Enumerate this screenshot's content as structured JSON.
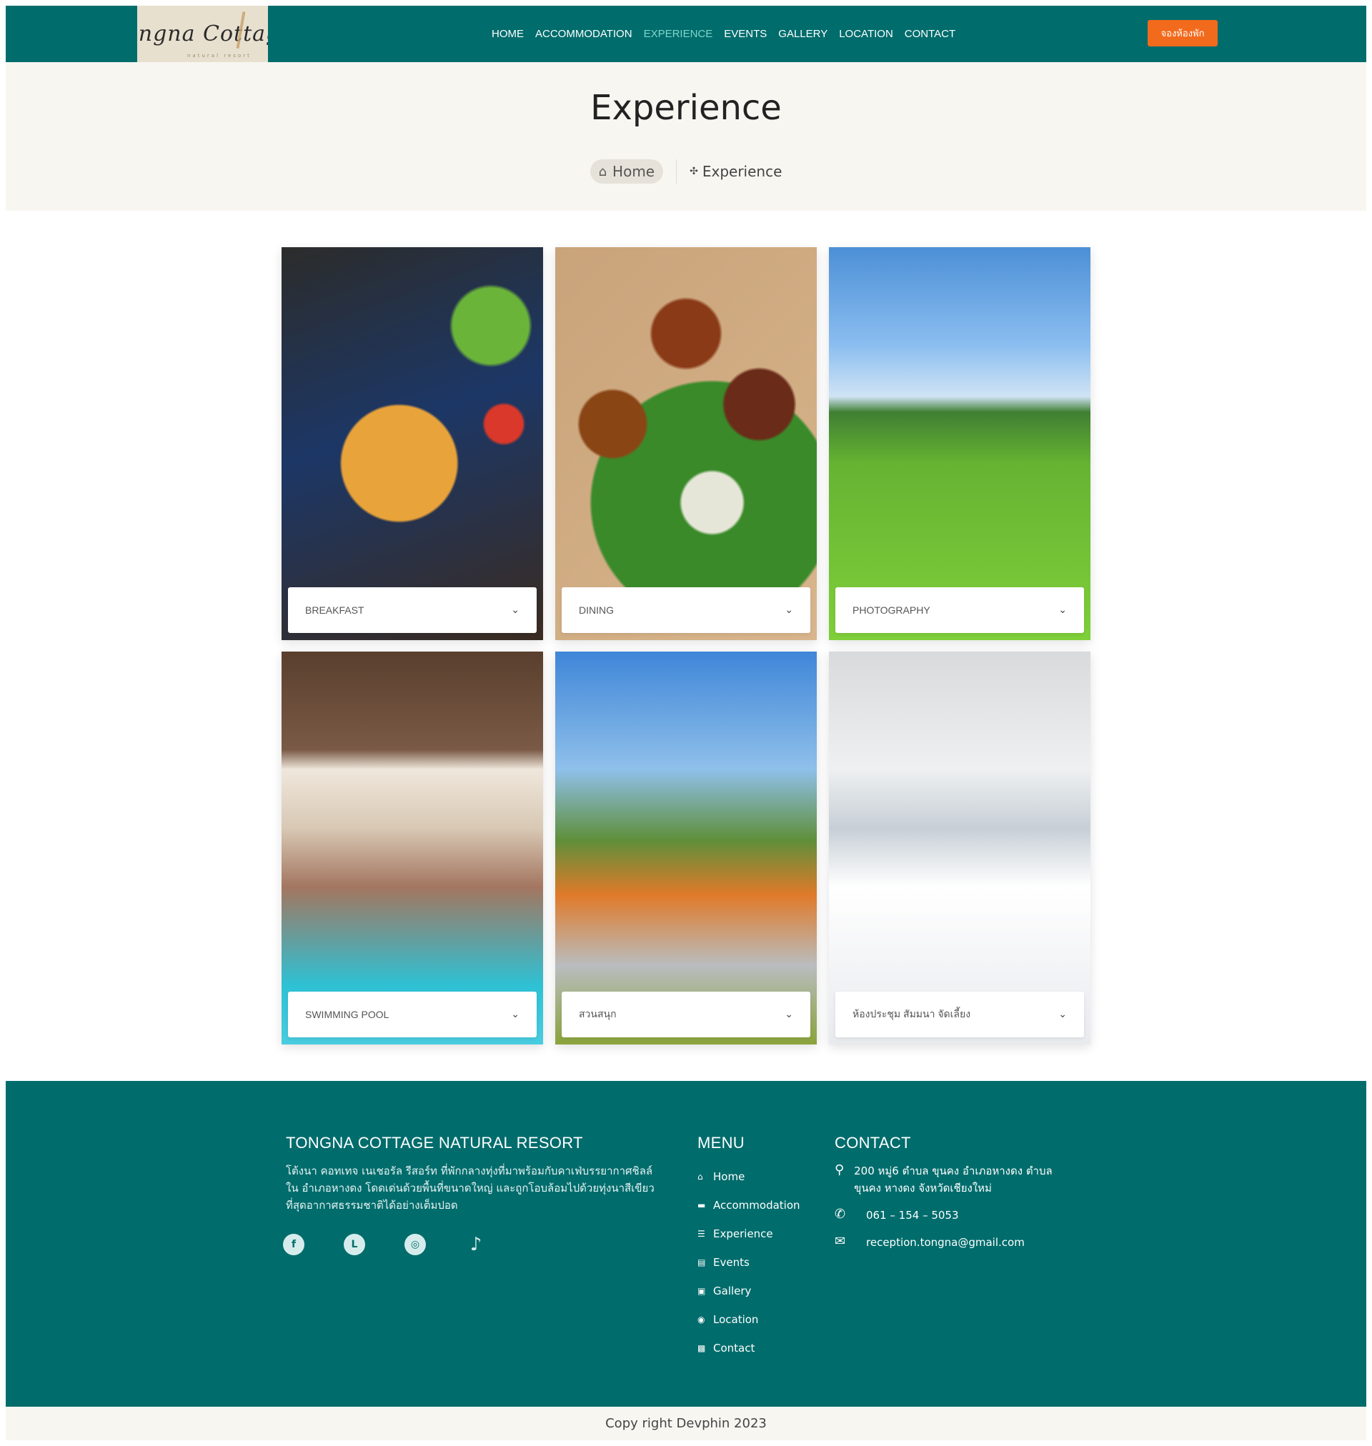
{
  "brand": {
    "logo_text": "Tongna Cottage",
    "logo_sub": "natural resort"
  },
  "nav": {
    "items": [
      "HOME",
      "ACCOMMODATION",
      "EXPERIENCE",
      "EVENTS",
      "GALLERY",
      "LOCATION",
      "CONTACT"
    ],
    "active": "EXPERIENCE",
    "book_label": "จองห้องพัก"
  },
  "page": {
    "title": "Experience",
    "breadcrumb_home": "Home",
    "breadcrumb_current": "Experience"
  },
  "cards": [
    {
      "label": "BREAKFAST"
    },
    {
      "label": "DINING"
    },
    {
      "label": "PHOTOGRAPHY"
    },
    {
      "label": "SWIMMING POOL"
    },
    {
      "label": "สวนสนุก"
    },
    {
      "label": "ห้องประชุม สัมมนา จัดเลี้ยง"
    }
  ],
  "footer": {
    "title": "TONGNA COTTAGE NATURAL RESORT",
    "description": "โต้งนา คอทเทจ เนเชอรัล รีสอร์ท ที่พักกลางทุ่งที่มาพร้อมกับคาเฟ่บรรยากาศชิลล์ใน อำเภอหางดง โดดเด่นด้วยพื้นที่ขนาดใหญ่ และถูกโอบล้อมไปด้วยทุ่งนาสีเขียว ที่สุดอากาศธรรมชาติได้อย่างเต็มปอด",
    "menu_title": "MENU",
    "menu": [
      "Home",
      "Accommodation",
      "Experience",
      "Events",
      "Gallery",
      "Location",
      "Contact"
    ],
    "contact_title": "CONTACT",
    "address": "200 หมู่6 ตำบล ขุนคง อำเภอหางดง ตำบล ขุนคง หางดง จังหวัดเชียงใหม่",
    "phone": "061 – 154 – 5053",
    "email": "reception.tongna@gmail.com",
    "socials": [
      "facebook-icon",
      "line-icon",
      "instagram-icon",
      "tiktok-icon"
    ]
  },
  "copyright": "Copy right Devphin 2023",
  "colors": {
    "primary": "#006c6c",
    "accent": "#f26a1b",
    "band": "#f7f6f1"
  }
}
